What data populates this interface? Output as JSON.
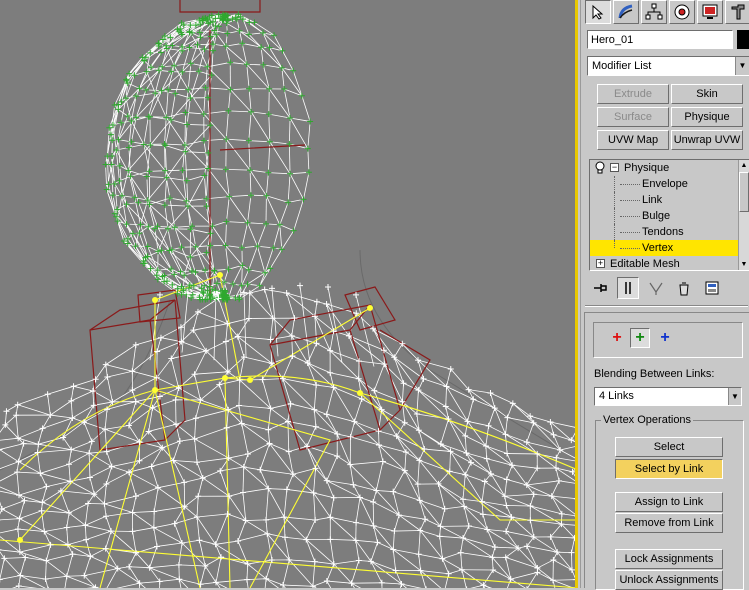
{
  "viewport": {
    "name": "Perspective viewport",
    "background": "#7d7d7d",
    "mesh_color": "#ffffff",
    "vertex_color": "#2fa82f",
    "link_color": "#ffff33",
    "bone_color": "#8a1a1a",
    "border_color": "#e8c800"
  },
  "command_panel": {
    "tabs": [
      {
        "icon": "create-icon",
        "active": true
      },
      {
        "icon": "modify-icon",
        "active": false
      },
      {
        "icon": "hierarchy-icon",
        "active": false
      },
      {
        "icon": "motion-icon",
        "active": false
      },
      {
        "icon": "display-icon",
        "active": false
      },
      {
        "icon": "utilities-icon",
        "active": false
      }
    ],
    "object_name": "Hero_01",
    "object_color": "#000000",
    "modifier_list": "Modifier List",
    "modifier_buttons": {
      "extrude": "Extrude",
      "skin": "Skin",
      "surface": "Surface",
      "physique": "Physique",
      "uvw_map": "UVW Map",
      "unwrap_uvw": "Unwrap UVW"
    },
    "stack": {
      "physique": "Physique",
      "expand_minus": "−",
      "children": [
        "Envelope",
        "Link",
        "Bulge",
        "Tendons",
        "Vertex"
      ],
      "selected": "Vertex",
      "editable_mesh": "Editable Mesh",
      "expand_plus": "+"
    },
    "blending_label": "Blending Between Links:",
    "blending_value": "4 Links",
    "vertex_ops_title": "Vertex Operations",
    "buttons": {
      "select": "Select",
      "select_by_link": "Select by Link",
      "assign_to_link": "Assign to Link",
      "remove_from_link": "Remove from Link",
      "lock_assignments": "Lock Assignments",
      "unlock_assignments": "Unlock Assignments"
    },
    "type_colors": {
      "red": "#dd1111",
      "green": "#118811",
      "blue": "#1133cc"
    }
  }
}
